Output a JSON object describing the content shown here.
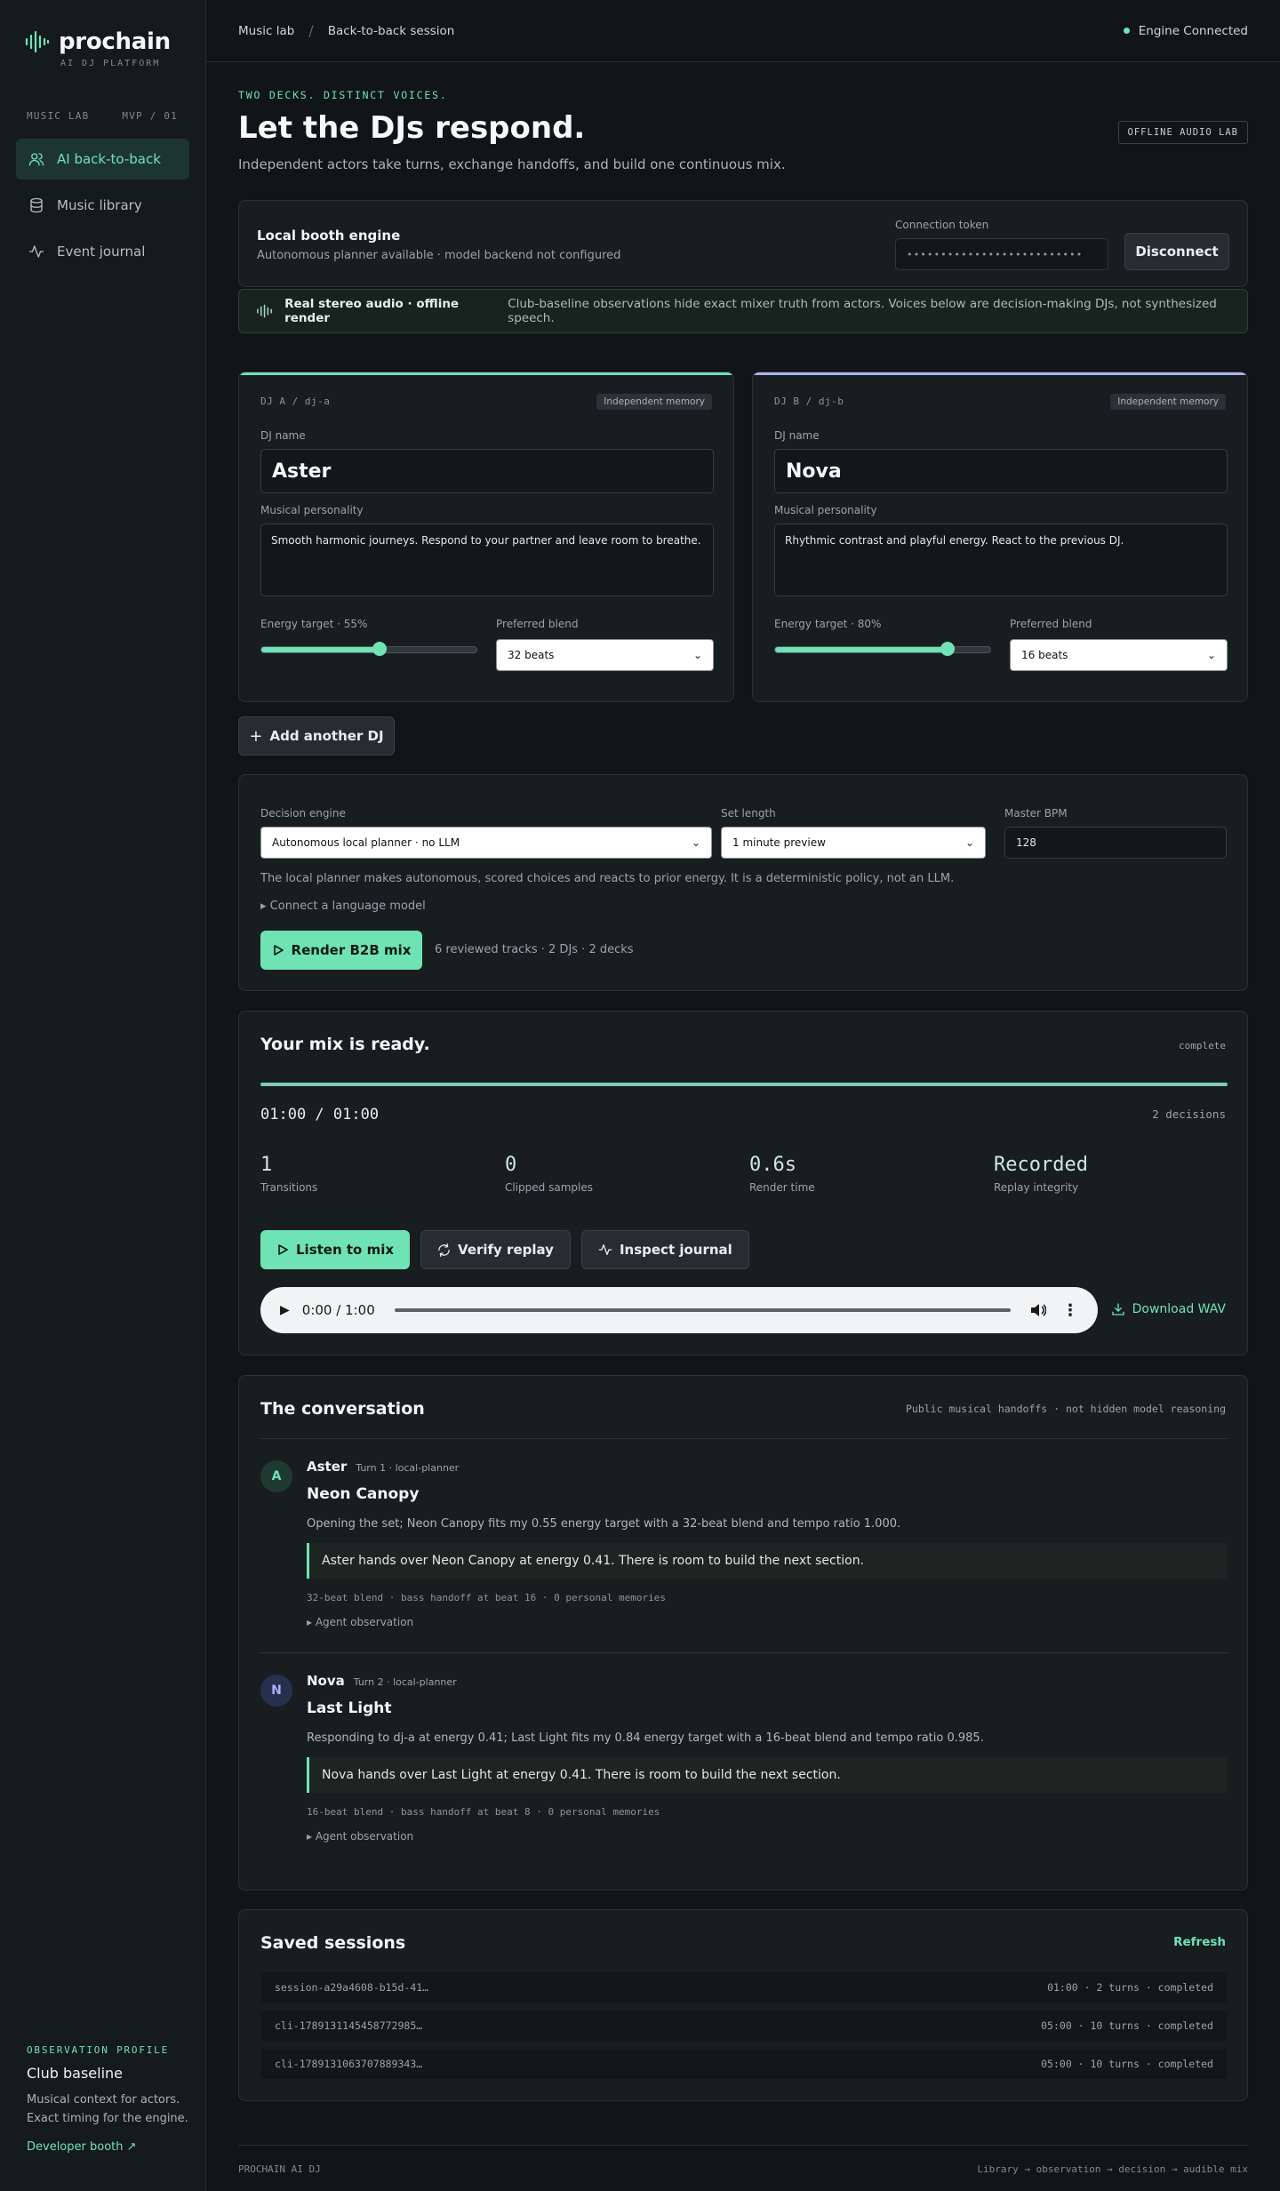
{
  "brand": {
    "name": "prochain",
    "tagline": "AI DJ PLATFORM"
  },
  "sidebar": {
    "section_label": "MUSIC LAB",
    "version": "MVP / 01",
    "items": [
      {
        "label": "AI back-to-back",
        "icon": "users-icon",
        "active": true
      },
      {
        "label": "Music library",
        "icon": "database-icon",
        "active": false
      },
      {
        "label": "Event journal",
        "icon": "activity-icon",
        "active": false
      }
    ],
    "observation": {
      "label": "OBSERVATION PROFILE",
      "title": "Club baseline",
      "desc_line1": "Musical context for actors.",
      "desc_line2": "Exact timing for the engine.",
      "link": "Developer booth ↗"
    }
  },
  "topbar": {
    "breadcrumb": [
      "Music lab",
      "Back-to-back session"
    ],
    "engine_status": "Engine Connected"
  },
  "hero": {
    "eyebrow": "TWO DECKS. DISTINCT VOICES.",
    "title": "Let the DJs respond.",
    "lede": "Independent actors take turns, exchange handoffs, and build one continuous mix.",
    "badge": "OFFLINE AUDIO LAB"
  },
  "booth": {
    "title": "Local booth engine",
    "subtitle": "Autonomous planner available · model backend not configured",
    "token_label": "Connection token",
    "token_value": "••••••••••••••••••••••••••",
    "disconnect": "Disconnect"
  },
  "banner": {
    "title": "Real stereo audio · offline render",
    "text": "Club-baseline observations hide exact mixer truth from actors. Voices below are decision-making DJs, not synthesized speech."
  },
  "djs": [
    {
      "id": "DJ A / dj-a",
      "memory": "Independent memory",
      "name_label": "DJ name",
      "name": "Aster",
      "personality_label": "Musical personality",
      "personality": "Smooth harmonic journeys. Respond to your partner and leave room to breathe.",
      "energy_label": "Energy target · 55%",
      "energy": 0.55,
      "blend_label": "Preferred blend",
      "blend": "32 beats",
      "accent": "#6fe3b4"
    },
    {
      "id": "DJ B / dj-b",
      "memory": "Independent memory",
      "name_label": "DJ name",
      "name": "Nova",
      "personality_label": "Musical personality",
      "personality": "Rhythmic contrast and playful energy. React to the previous DJ.",
      "energy_label": "Energy target · 80%",
      "energy": 0.8,
      "blend_label": "Preferred blend",
      "blend": "16 beats",
      "accent": "#a9b4f5"
    }
  ],
  "add_dj": "Add another DJ",
  "settings": {
    "engine_label": "Decision engine",
    "engine_value": "Autonomous local planner · no LLM",
    "length_label": "Set length",
    "length_value": "1 minute preview",
    "bpm_label": "Master BPM",
    "bpm_value": "128",
    "note": "The local planner makes autonomous, scored choices and reacts to prior energy. It is a deterministic policy, not an LLM.",
    "llm_toggle": "▸ Connect a language model",
    "render": "Render B2B mix",
    "render_meta": "6 reviewed tracks · 2 DJs · 2 decks"
  },
  "mix": {
    "title": "Your mix is ready.",
    "status": "complete",
    "progress": 1.0,
    "time": "01:00 / 01:00",
    "decisions": "2 decisions",
    "stats": [
      {
        "value": "1",
        "label": "Transitions"
      },
      {
        "value": "0",
        "label": "Clipped samples"
      },
      {
        "value": "0.6s",
        "label": "Render time"
      },
      {
        "value": "Recorded",
        "label": "Replay integrity"
      }
    ],
    "listen": "Listen to mix",
    "verify": "Verify replay",
    "inspect": "Inspect journal",
    "player_time": "0:00 / 1:00",
    "download": "Download WAV"
  },
  "conversation": {
    "title": "The conversation",
    "subtitle": "Public musical handoffs · not hidden model reasoning",
    "turns": [
      {
        "initial": "A",
        "dj": "Aster",
        "meta": "Turn 1 · local-planner",
        "track": "Neon Canopy",
        "reason": "Opening the set; Neon Canopy fits my 0.55 energy target with a 32-beat blend and tempo ratio 1.000.",
        "handoff": "Aster hands over Neon Canopy at energy 0.41. There is room to build the next section.",
        "tech": "32-beat blend · bass handoff at beat 16 · 0 personal memories",
        "observation": "▸ Agent observation"
      },
      {
        "initial": "N",
        "dj": "Nova",
        "meta": "Turn 2 · local-planner",
        "track": "Last Light",
        "reason": "Responding to dj-a at energy 0.41; Last Light fits my 0.84 energy target with a 16-beat blend and tempo ratio 0.985.",
        "handoff": "Nova hands over Last Light at energy 0.41. There is room to build the next section.",
        "tech": "16-beat blend · bass handoff at beat 8 · 0 personal memories",
        "observation": "▸ Agent observation"
      }
    ]
  },
  "saved": {
    "title": "Saved sessions",
    "refresh": "Refresh",
    "rows": [
      {
        "id": "session-a29a4608-b15d-41…",
        "info": "01:00 · 2 turns · completed"
      },
      {
        "id": "cli-1789131145458772985…",
        "info": "05:00 · 10 turns · completed"
      },
      {
        "id": "cli-1789131063707889343…",
        "info": "05:00 · 10 turns · completed"
      }
    ]
  },
  "footer": {
    "left": "PROCHAIN AI DJ",
    "right": "Library → observation → decision → audible mix"
  }
}
